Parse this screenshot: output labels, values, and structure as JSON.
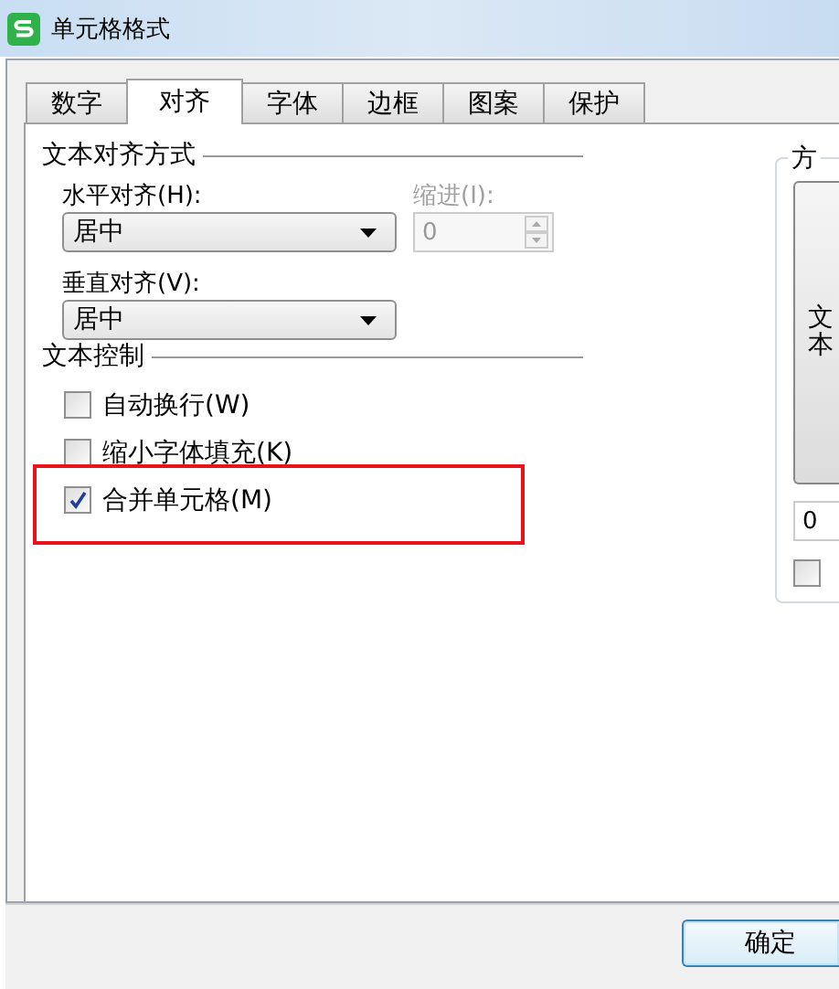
{
  "window": {
    "title": "单元格格式"
  },
  "tabs": [
    {
      "label": "数字",
      "selected": false
    },
    {
      "label": "对齐",
      "selected": true
    },
    {
      "label": "字体",
      "selected": false
    },
    {
      "label": "边框",
      "selected": false
    },
    {
      "label": "图案",
      "selected": false
    },
    {
      "label": "保护",
      "selected": false
    }
  ],
  "text_alignment": {
    "title": "文本对齐方式",
    "horizontal": {
      "label": "水平对齐(H):",
      "value": "居中"
    },
    "indent": {
      "label": "缩进(I):",
      "value": "0",
      "disabled": true
    },
    "vertical": {
      "label": "垂直对齐(V):",
      "value": "居中"
    }
  },
  "text_control": {
    "title": "文本控制",
    "options": [
      {
        "label": "自动换行(W)",
        "checked": false,
        "highlighted": false
      },
      {
        "label": "缩小字体填充(K)",
        "checked": false,
        "highlighted": false
      },
      {
        "label": "合并单元格(M)",
        "checked": true,
        "highlighted": true
      }
    ]
  },
  "orientation": {
    "title": "方",
    "vertical_text": "文本",
    "degrees": "0",
    "checked": false
  },
  "buttons": [
    "确定"
  ]
}
